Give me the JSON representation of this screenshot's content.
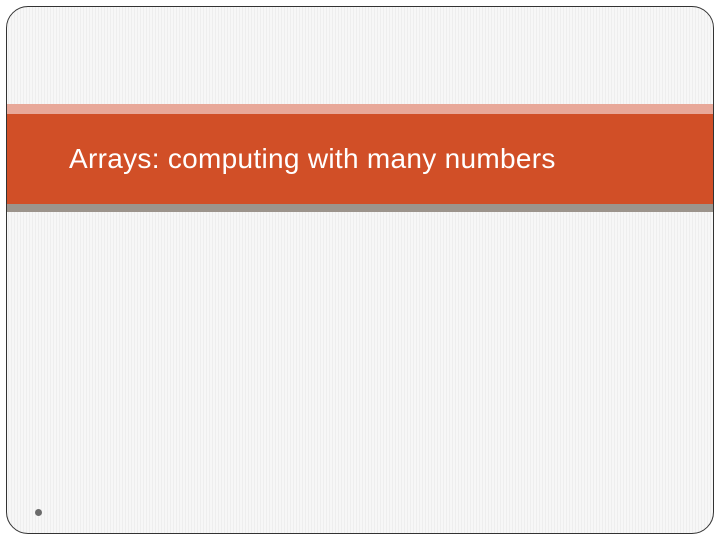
{
  "slide": {
    "title": "Arrays: computing with many numbers",
    "colors": {
      "band": "#d14f27",
      "accent_top": "#e8a899",
      "accent_bottom": "#9c948c"
    }
  }
}
